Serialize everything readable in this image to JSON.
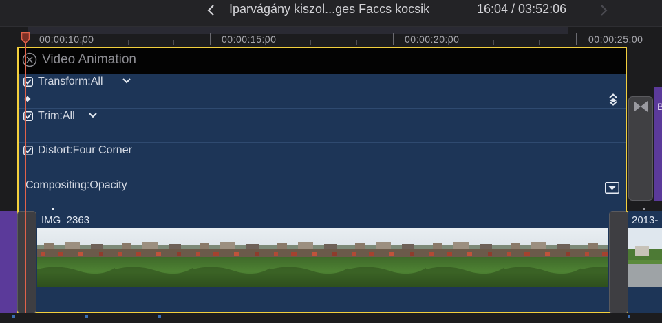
{
  "header": {
    "project_title": "Iparvágány kiszol...ges Faccs kocsik",
    "timecode": "16:04 / 03:52:06"
  },
  "ruler": {
    "labels": [
      "00:00:10:00",
      "00:00:15:00",
      "00:00:20:00",
      "00:00:25:00"
    ]
  },
  "animation_editor": {
    "title": "Video Animation",
    "params": [
      {
        "label": "Transform:All",
        "checked": true,
        "has_menu": true
      },
      {
        "label": "Trim:All",
        "checked": true,
        "has_menu": true
      },
      {
        "label": "Distort:Four Corner",
        "checked": true,
        "has_menu": false
      },
      {
        "label": "Compositing:Opacity",
        "checked": false,
        "has_menu": false
      }
    ]
  },
  "clips": {
    "main_name": "IMG_2363",
    "next_name": "2013-",
    "right_purple_label": "B"
  },
  "colors": {
    "accent_yellow": "#f2cf3d",
    "clip_blue": "#1d3557",
    "purple": "#5b3a9a",
    "playhead": "#e0624a"
  }
}
